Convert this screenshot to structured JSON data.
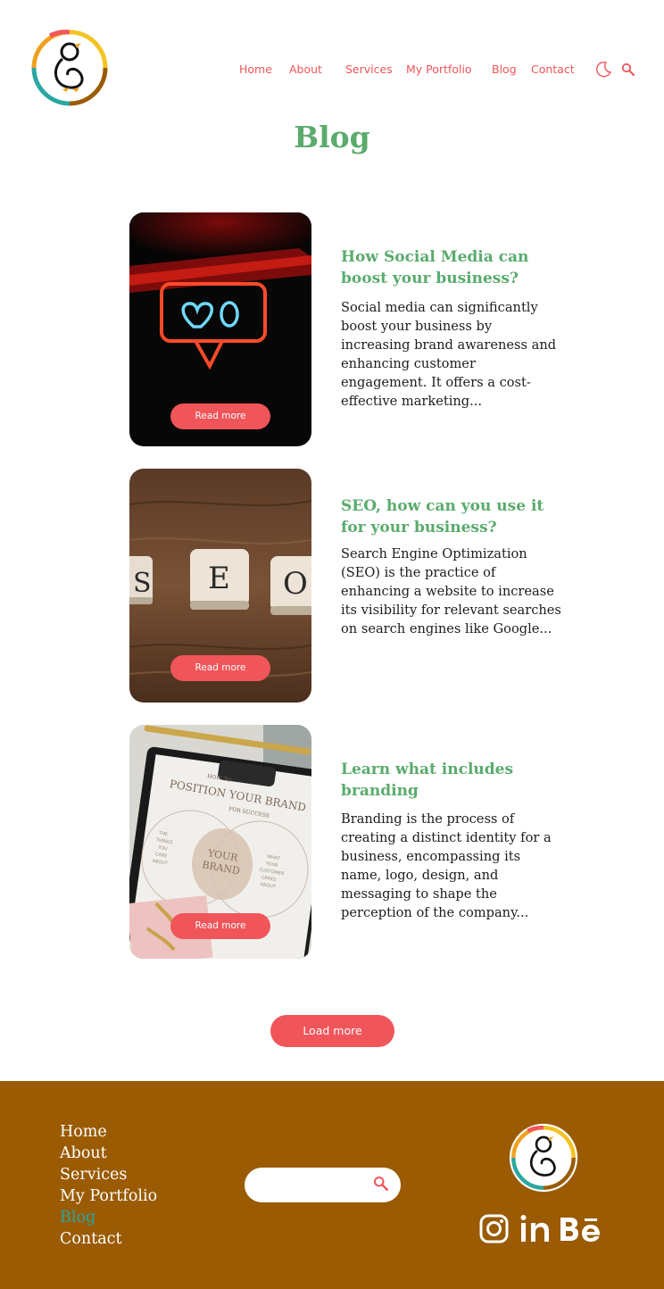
{
  "header": {
    "logo_icon": "penguin-logo-icon",
    "nav": [
      "Home",
      "About",
      "Services",
      "My Portfolio",
      "Blog",
      "Contact"
    ],
    "theme_toggle_icon": "moon-icon",
    "search_icon": "search-icon"
  },
  "page": {
    "title": "Blog"
  },
  "posts": [
    {
      "image": "neon-like-sign",
      "title": "How Social Media can boost your business?",
      "excerpt": "Social media can significantly boost your business by increasing brand awareness and enhancing customer engagement. It offers a cost-effective marketing...",
      "button": "Read more"
    },
    {
      "image": "scrabble-seo-tiles",
      "title": "SEO, how can you use it for your business?",
      "excerpt": "Search Engine Optimization (SEO) is the practice of enhancing a website to increase its visibility for relevant searches on search engines like Google...",
      "button": "Read more"
    },
    {
      "image": "branding-clipboard",
      "title": "Learn what includes branding",
      "excerpt": "Branding is the process of creating a distinct identity for a business, encompassing its name, logo, design, and messaging to shape the perception of the company...",
      "button": "Read more"
    }
  ],
  "load_more": "Load more",
  "image_text": {
    "seo_tiles": [
      "S",
      "E",
      "O"
    ],
    "clipboard_heading": "POSITION YOUR BRAND",
    "clipboard_small": [
      "HOW TO",
      "FOR SUCCESS"
    ],
    "clipboard_center": [
      "YOUR",
      "BRAND"
    ],
    "clipboard_left": [
      "THE",
      "THINGS",
      "YOU",
      "CARE",
      "ABOUT"
    ],
    "clipboard_right": [
      "WHAT",
      "YOUR",
      "CUSTOMER",
      "CARES",
      "ABOUT"
    ]
  },
  "footer": {
    "nav": [
      "Home",
      "About",
      "Services",
      "My Portfolio",
      "Blog",
      "Contact"
    ],
    "active": "Blog",
    "search_placeholder": "",
    "social": [
      "instagram-icon",
      "linkedin-icon",
      "behance-icon"
    ]
  },
  "colors": {
    "accent_red": "#f0555a",
    "title_green": "#5aab6d",
    "footer_brown": "#9a5b03",
    "active_teal": "#2aa7a0"
  }
}
